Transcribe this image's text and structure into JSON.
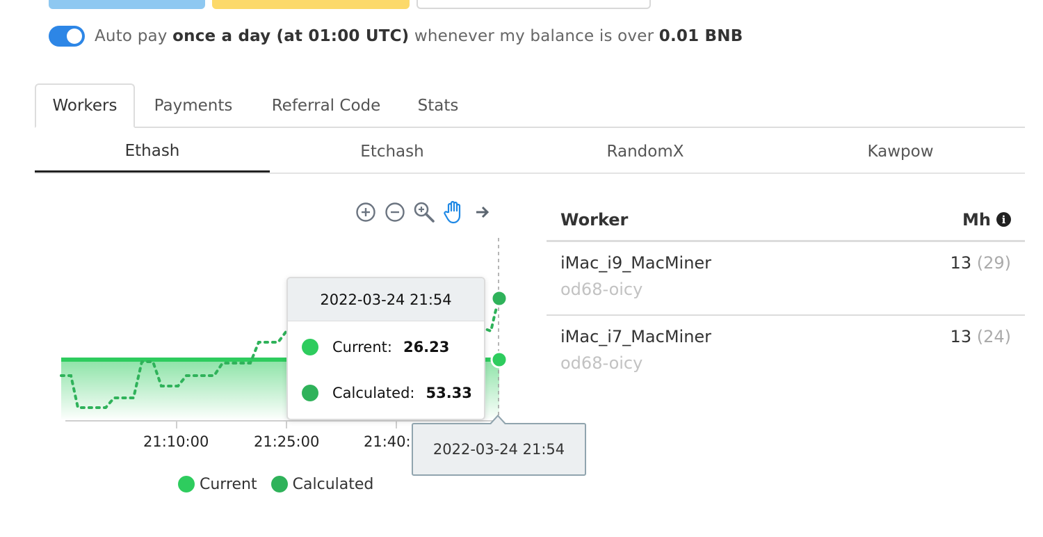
{
  "autopay": {
    "prefix": "Auto pay ",
    "frequency": "once a day (at 01:00 UTC)",
    "middle": " whenever my balance is over ",
    "threshold": "0.01 BNB",
    "enabled": true
  },
  "tabs": [
    {
      "label": "Workers",
      "active": true
    },
    {
      "label": "Payments",
      "active": false
    },
    {
      "label": "Referral Code",
      "active": false
    },
    {
      "label": "Stats",
      "active": false
    }
  ],
  "subtabs": [
    {
      "label": "Ethash",
      "active": true
    },
    {
      "label": "Etchash",
      "active": false
    },
    {
      "label": "RandomX",
      "active": false
    },
    {
      "label": "Kawpow",
      "active": false
    }
  ],
  "chart_toolbar": [
    "zoom-in-icon",
    "zoom-out-icon",
    "selection-zoom-icon",
    "pan-hand-icon",
    "reset-arrow-icon"
  ],
  "colors": {
    "current": "#2ecc5e",
    "calculated": "#2fb25a",
    "accent": "#2d86e6"
  },
  "chart_data": {
    "type": "area",
    "x_ticks": [
      "21:10:00",
      "21:25:00",
      "21:40:"
    ],
    "series": [
      {
        "name": "Current",
        "style": "area"
      },
      {
        "name": "Calculated",
        "style": "dotted-line"
      }
    ],
    "tooltip": {
      "time": "2022-03-24 21:54",
      "current_label": "Current:",
      "current_value": "26.23",
      "calculated_label": "Calculated:",
      "calculated_value": "53.33"
    },
    "crosshair_label": "2022-03-24 21:54",
    "legend": [
      "Current",
      "Calculated"
    ]
  },
  "workers_table": {
    "col_worker": "Worker",
    "col_mh": "Mh",
    "rows": [
      {
        "name": "iMac_i9_MacMiner",
        "sub": "od68-oicy",
        "value": "13",
        "secondary": "(29)"
      },
      {
        "name": "iMac_i7_MacMiner",
        "sub": "od68-oicy",
        "value": "13",
        "secondary": "(24)"
      }
    ]
  }
}
